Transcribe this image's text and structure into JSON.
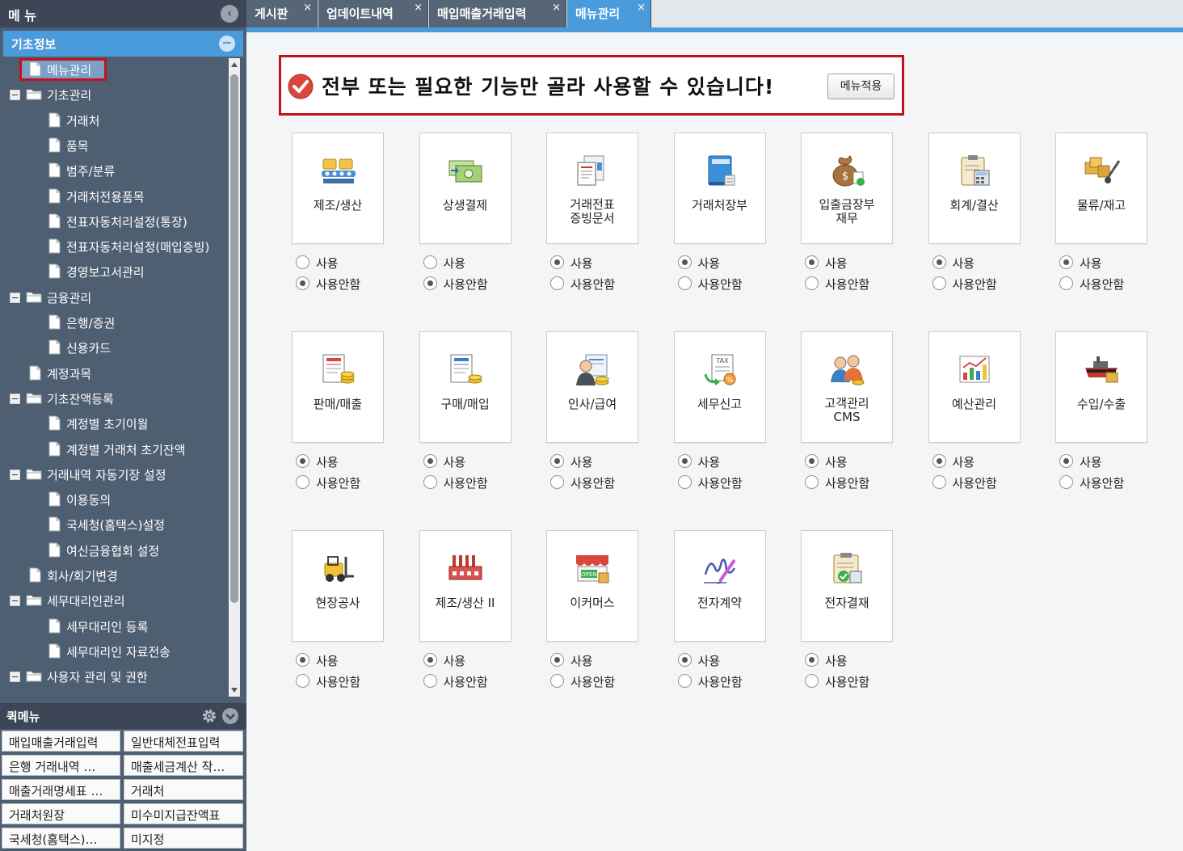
{
  "menu_header": "메 뉴",
  "section_title": "기초정보",
  "tree": [
    {
      "label": "메뉴관리",
      "type": "doc",
      "level": 1,
      "selected": true
    },
    {
      "label": "기초관리",
      "type": "folder",
      "level": 0
    },
    {
      "label": "거래처",
      "type": "doc",
      "level": 2
    },
    {
      "label": "품목",
      "type": "doc",
      "level": 2
    },
    {
      "label": "범주/분류",
      "type": "doc",
      "level": 2
    },
    {
      "label": "거래처전용품목",
      "type": "doc",
      "level": 2
    },
    {
      "label": "전표자동처리설정(통장)",
      "type": "doc",
      "level": 2
    },
    {
      "label": "전표자동처리설정(매입증빙)",
      "type": "doc",
      "level": 2
    },
    {
      "label": "경영보고서관리",
      "type": "doc",
      "level": 2
    },
    {
      "label": "금융관리",
      "type": "folder",
      "level": 0
    },
    {
      "label": "은행/증권",
      "type": "doc",
      "level": 2
    },
    {
      "label": "신용카드",
      "type": "doc",
      "level": 2
    },
    {
      "label": "계정과목",
      "type": "doc",
      "level": 1
    },
    {
      "label": "기초잔액등록",
      "type": "folder",
      "level": 0
    },
    {
      "label": "계정별 초기이월",
      "type": "doc",
      "level": 2
    },
    {
      "label": "계정별 거래처 초기잔액",
      "type": "doc",
      "level": 2
    },
    {
      "label": "거래내역 자동기장 설정",
      "type": "folder",
      "level": 0
    },
    {
      "label": "이용동의",
      "type": "doc",
      "level": 2
    },
    {
      "label": "국세청(홈택스)설정",
      "type": "doc",
      "level": 2
    },
    {
      "label": "여신금융협회 설정",
      "type": "doc",
      "level": 2
    },
    {
      "label": "회사/회기변경",
      "type": "doc",
      "level": 1
    },
    {
      "label": "세무대리인관리",
      "type": "folder",
      "level": 0
    },
    {
      "label": "세무대리인 등록",
      "type": "doc",
      "level": 2
    },
    {
      "label": "세무대리인 자료전송",
      "type": "doc",
      "level": 2
    },
    {
      "label": "사용자 관리 및 권한",
      "type": "folder",
      "level": 0
    }
  ],
  "quick_menu": {
    "title": "퀵메뉴",
    "items": [
      "매입매출거래입력",
      "일반대체전표입력",
      "은행 거래내역 …",
      "매출세금계산 작…",
      "매출거래명세표 …",
      "거래처",
      "거래처원장",
      "미수미지급잔액표",
      "국세청(홈택스)…",
      "미지정"
    ]
  },
  "tabs": [
    {
      "label": "게시판",
      "active": false
    },
    {
      "label": "업데이트내역",
      "active": false
    },
    {
      "label": "매입매출거래입력",
      "active": false
    },
    {
      "label": "메뉴관리",
      "active": true
    }
  ],
  "tab_close_glyph": "×",
  "notice": {
    "text": "전부 또는 필요한 기능만 골라 사용할 수 있습니다!",
    "apply_label": "메뉴적용"
  },
  "options": {
    "use": "사용",
    "not_use": "사용안함"
  },
  "modules": [
    {
      "name": "제조/생산",
      "icon": "conveyor-icon",
      "used": false
    },
    {
      "name": "상생결제",
      "icon": "money-icon",
      "used": false
    },
    {
      "name": "거래전표\n증빙문서",
      "icon": "voucher-icon",
      "used": true
    },
    {
      "name": "거래처장부",
      "icon": "ledger-book-icon",
      "used": true
    },
    {
      "name": "입출금장부\n재무",
      "icon": "money-bag-icon",
      "used": true
    },
    {
      "name": "회계/결산",
      "icon": "clipboard-calc-icon",
      "used": true
    },
    {
      "name": "물류/재고",
      "icon": "hand-truck-icon",
      "used": true
    },
    {
      "name": "판매/매출",
      "icon": "sales-doc-icon",
      "used": true
    },
    {
      "name": "구매/매입",
      "icon": "purchase-doc-icon",
      "used": true
    },
    {
      "name": "인사/급여",
      "icon": "person-coins-icon",
      "used": true
    },
    {
      "name": "세무신고",
      "icon": "tax-doc-icon",
      "used": true
    },
    {
      "name": "고객관리\nCMS",
      "icon": "customers-icon",
      "used": true
    },
    {
      "name": "예산관리",
      "icon": "budget-chart-icon",
      "used": true
    },
    {
      "name": "수입/수출",
      "icon": "ship-icon",
      "used": true
    },
    {
      "name": "현장공사",
      "icon": "forklift-icon",
      "used": true
    },
    {
      "name": "제조/생산 II",
      "icon": "factory-icon",
      "used": true
    },
    {
      "name": "이커머스",
      "icon": "shop-icon",
      "used": true
    },
    {
      "name": "전자계약",
      "icon": "signature-icon",
      "used": true
    },
    {
      "name": "전자결재",
      "icon": "approval-icon",
      "used": true
    }
  ],
  "colors": {
    "accent": "#4a9bdc",
    "highlight_border": "#c0121f",
    "sidebar_bg": "#4f5f72"
  }
}
